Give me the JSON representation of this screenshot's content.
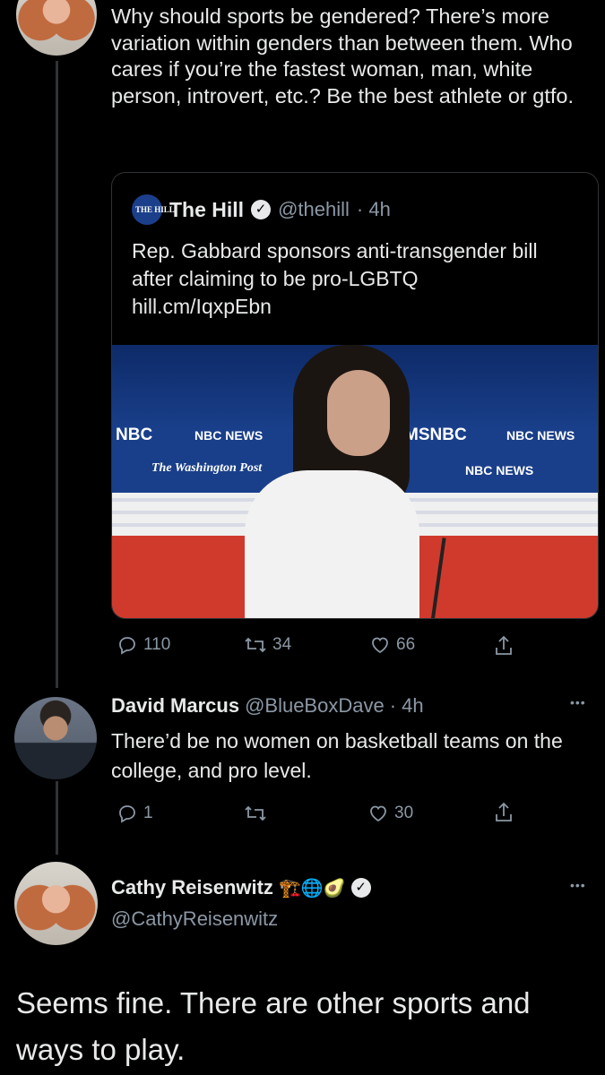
{
  "tweets": {
    "top": {
      "text": "Why should sports be gendered? There’s more variation within genders than between them. Who cares if you’re the fastest woman, man, white person, introvert, etc.? Be the best athlete or gtfo.",
      "quote": {
        "logo": "THE HILL",
        "name": "The Hill",
        "handle": "@thehill",
        "time": "· 4h",
        "text": "Rep. Gabbard sponsors anti-transgender bill after claiming to be pro-LGBTQ hill.cm/IqxpEbn",
        "image_labels": [
          "NBC",
          "NBC NEWS",
          "MSNBC",
          "NBC NEWS",
          "The Washington Post",
          "NBC NEWS"
        ]
      },
      "actions": {
        "replies": "110",
        "retweets": "34",
        "likes": "66"
      }
    },
    "reply": {
      "name": "David Marcus",
      "handle": "@BlueBoxDave",
      "time": "· 4h",
      "text": "There’d be no women on basketball teams on the college, and pro level.",
      "actions": {
        "replies": "1",
        "retweets": "",
        "likes": "30"
      },
      "more": "•••"
    },
    "main": {
      "name": "Cathy Reisenwitz",
      "name_emoji": "🏗️🌐🥑",
      "handle": "@CathyReisenwitz",
      "text": "Seems fine. There are other sports and ways to play.",
      "more": "•••"
    }
  },
  "icons": {
    "reply": "reply-icon",
    "retweet": "retweet-icon",
    "like": "like-icon",
    "share": "share-icon",
    "verified": "verified-icon"
  },
  "colors": {
    "background": "#000000",
    "text": "#e7e9ea",
    "muted": "#8b98a5",
    "divider": "#2f3336",
    "stage_blue": "#1a3f8a",
    "stage_red": "#d03a2c"
  }
}
